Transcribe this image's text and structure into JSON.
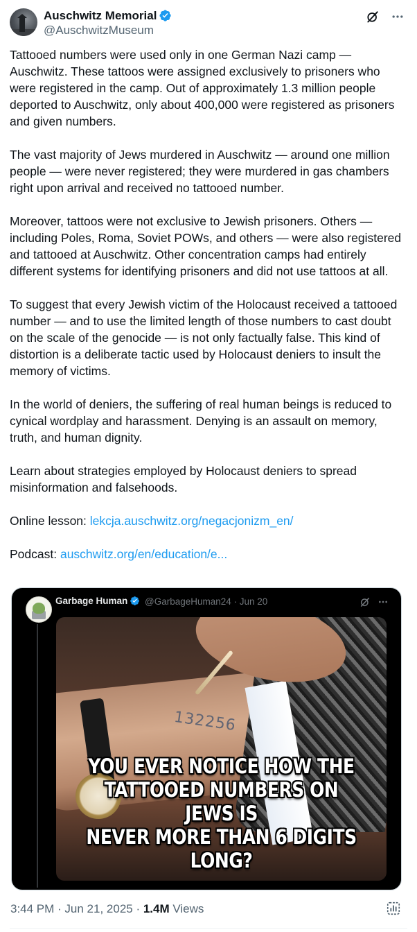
{
  "header": {
    "display_name": "Auschwitz Memorial",
    "handle": "@AuschwitzMuseum",
    "verified_icon": "verified-badge-icon",
    "grok_icon": "grok-icon",
    "more_icon": "more-horizontal-icon"
  },
  "tweet": {
    "paragraphs": [
      "Tattooed numbers were used only in one German Nazi camp — Auschwitz. These tattoos were assigned exclusively to prisoners who were registered in the camp. Out of approximately 1.3 million people deported to Auschwitz, only about 400,000 were registered as prisoners and given numbers.",
      "The vast majority of Jews murdered in Auschwitz — around one million people — were never registered; they were murdered in gas chambers right upon arrival and received no tattooed number.",
      "Moreover, tattoos were not exclusive to Jewish prisoners. Others — including Poles, Roma, Soviet POWs, and others — were also registered and tattooed at Auschwitz. Other concentration camps had entirely different systems for identifying prisoners and did not use tattoos at all.",
      "To suggest that every Jewish victim of the Holocaust received a tattooed number — and to use the limited length of those numbers to cast doubt on the scale of the genocide — is not only factually false. This kind of distortion is a deliberate tactic used by Holocaust deniers to insult the memory of victims.",
      "In the world of deniers, the suffering of real human beings is reduced to cynical wordplay and harassment. Denying is an assault on memory, truth, and human dignity.",
      "Learn about strategies employed by Holocaust deniers to spread misinformation and falsehoods."
    ],
    "lesson_label": "Online lesson: ",
    "lesson_link": "lekcja.auschwitz.org/negacjonizm_en/",
    "podcast_label": "Podcast: ",
    "podcast_link": "auschwitz.org/en/education/e..."
  },
  "quote": {
    "display_name": "Garbage Human",
    "handle_date": "@GarbageHuman24 · Jun 20",
    "tattoo_number": "132256",
    "meme_lines": [
      "YOU EVER NOTICE HOW THE",
      "TATTOOED NUMBERS ON JEWS IS",
      "NEVER MORE THAN 6 DIGITS LONG?"
    ]
  },
  "meta": {
    "time": "3:44 PM",
    "sep1": " · ",
    "date": "Jun 21, 2025",
    "sep2": " · ",
    "views_count": "1.4M",
    "views_label": " Views",
    "analytics_icon": "analytics-icon"
  },
  "colors": {
    "text": "#0f1419",
    "secondary": "#536471",
    "link": "#1d9bf0",
    "verified": "#1d9bf0"
  }
}
